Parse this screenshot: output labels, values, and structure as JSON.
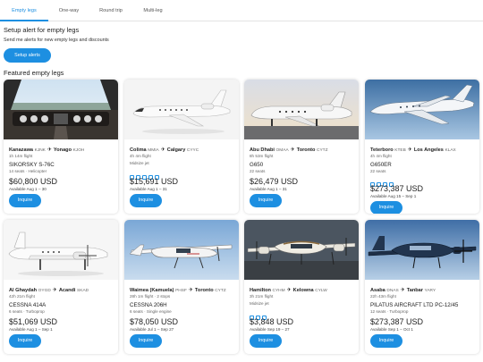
{
  "tabs": [
    {
      "label": "Empty legs",
      "active": true
    },
    {
      "label": "One-way",
      "active": false
    },
    {
      "label": "Round trip",
      "active": false
    },
    {
      "label": "Multi-leg",
      "active": false
    }
  ],
  "setup": {
    "heading": "Setup alert for empty legs",
    "subtext": "Send me alerts for new empty legs and discounts",
    "button_label": "Setup alerts"
  },
  "featured_heading": "Featured empty legs",
  "inquire_label": "Inquire",
  "accent_color": "#1d8fe1",
  "cards": [
    {
      "from": "Kanazawa",
      "from_code": "KJNK",
      "to": "Yonago",
      "to_code": "KJOH",
      "duration": "1h 14m flight",
      "model": "SIKORSKY S-76C",
      "meta": "14 seats · Helicopter",
      "tag": "",
      "amenities": 0,
      "price": "$60,800 USD",
      "avail": "Available Aug 1 – 30",
      "photo": "cockpit"
    },
    {
      "from": "Colima",
      "from_code": "MMIA",
      "to": "Calgary",
      "to_code": "CYYC",
      "duration": "4h 4m flight",
      "model": "",
      "meta": "",
      "tag": "Midsize jet",
      "amenities": 5,
      "price": "$15,691 USD",
      "avail": "Available Aug 1 – 31",
      "photo": "jet-white"
    },
    {
      "from": "Abu Dhabi",
      "from_code": "OMAA",
      "to": "Toronto",
      "to_code": "CYTZ",
      "duration": "8h 53m flight",
      "model": "G650",
      "meta": "22 seats",
      "tag": "",
      "amenities": 0,
      "price": "$26,479 USD",
      "avail": "Available Aug 1 – 31",
      "photo": "jet-sunset"
    },
    {
      "from": "Teterboro",
      "from_code": "KTEB",
      "to": "Los Angeles",
      "to_code": "KLAX",
      "duration": "4h 4m flight",
      "model": "G650ER",
      "meta": "22 seats",
      "tag": "",
      "amenities": 4,
      "price": "$273,387 USD",
      "avail": "Available Aug 15 – Sep 1",
      "photo": "jet-sky"
    },
    {
      "from": "Al Ghaydah",
      "from_code": "OYGD",
      "to": "Acandi",
      "to_code": "SKAD",
      "duration": "42h 21m flight",
      "model": "CESSNA 414A",
      "meta": "6 seats · Turboprop",
      "tag": "",
      "amenities": 0,
      "price": "$51,069 USD",
      "avail": "Available Aug 1 – Sep 1",
      "photo": "turboprop-white"
    },
    {
      "from": "Waimea (Kamuela)",
      "from_code": "PHSF",
      "to": "Toronto",
      "to_code": "CYTZ",
      "duration": "28h 1m flight · 2 stops",
      "model": "CESSNA 206H",
      "meta": "6 seats · Single engine",
      "tag": "",
      "amenities": 0,
      "price": "$78,050 USD",
      "avail": "Available Jul 1 – Sep 27",
      "photo": "cessna"
    },
    {
      "from": "Hamilton",
      "from_code": "CYHM",
      "to": "Kelowna",
      "to_code": "CYLW",
      "duration": "3h 21m flight",
      "model": "",
      "meta": "",
      "tag": "Midsize jet",
      "amenities": 3,
      "price": "$3,848 USD",
      "avail": "Available Sep 19 – 27",
      "photo": "twin-prop"
    },
    {
      "from": "Asaba",
      "from_code": "DNAS",
      "to": "Tanbar",
      "to_code": "YARY",
      "duration": "22h 43m flight",
      "model": "PILATUS AIRCRAFT LTD PC-12/45",
      "meta": "12 seats · Turboprop",
      "tag": "",
      "amenities": 0,
      "price": "$273,387 USD",
      "avail": "Available Sep 1 – Oct 1",
      "photo": "pilatus"
    }
  ]
}
